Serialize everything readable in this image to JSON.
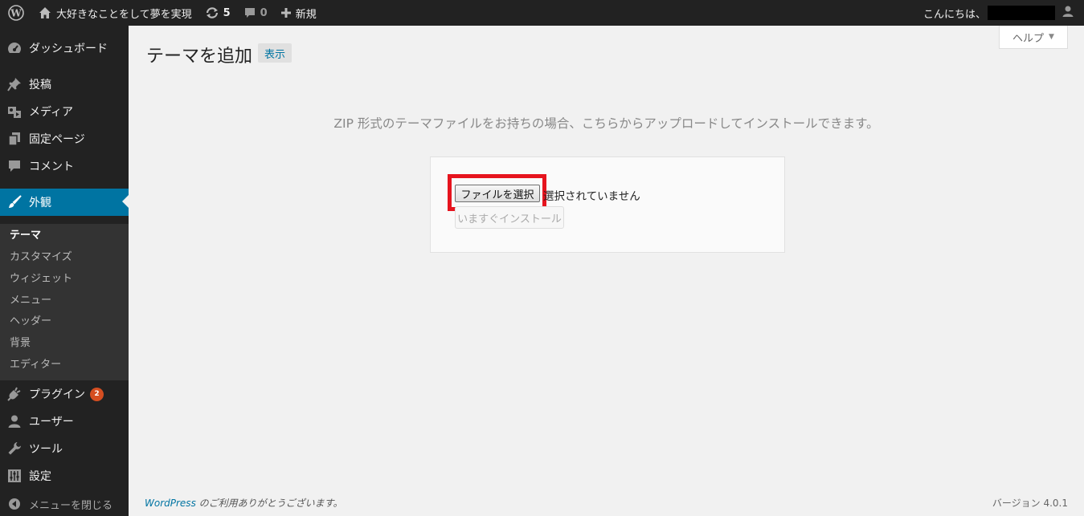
{
  "adminbar": {
    "site_name": "大好きなことをして夢を実現",
    "updates_count": "5",
    "comments_count": "0",
    "new_label": "新規",
    "greeting": "こんにちは、"
  },
  "sidebar": {
    "items": [
      {
        "label": "ダッシュボード",
        "icon": "dashboard-icon"
      },
      {
        "label": "投稿",
        "icon": "pushpin-icon"
      },
      {
        "label": "メディア",
        "icon": "media-icon"
      },
      {
        "label": "固定ページ",
        "icon": "page-icon"
      },
      {
        "label": "コメント",
        "icon": "comment-icon"
      },
      {
        "label": "外観",
        "icon": "paintbrush-icon"
      },
      {
        "label": "プラグイン",
        "icon": "plugin-icon",
        "badge": "2"
      },
      {
        "label": "ユーザー",
        "icon": "user-icon"
      },
      {
        "label": "ツール",
        "icon": "wrench-icon"
      },
      {
        "label": "設定",
        "icon": "settings-icon"
      }
    ],
    "submenu": [
      "テーマ",
      "カスタマイズ",
      "ウィジェット",
      "メニュー",
      "ヘッダー",
      "背景",
      "エディター"
    ],
    "collapse_label": "メニューを閉じる"
  },
  "main": {
    "help_label": "ヘルプ",
    "title": "テーマを追加",
    "browse_label": "表示",
    "upload_description": "ZIP 形式のテーマファイルをお持ちの場合、こちらからアップロードしてインストールできます。",
    "file_button_label": "ファイルを選択",
    "file_status": "選択されていません",
    "install_button_label": "いますぐインストール"
  },
  "footer": {
    "link_text": "WordPress",
    "thanks_text": " のご利用ありがとうございます。",
    "version": "バージョン 4.0.1"
  },
  "colors": {
    "adminbar_bg": "#222222",
    "accent": "#0074a2",
    "highlight": "#e6141e",
    "badge": "#d54e21"
  }
}
